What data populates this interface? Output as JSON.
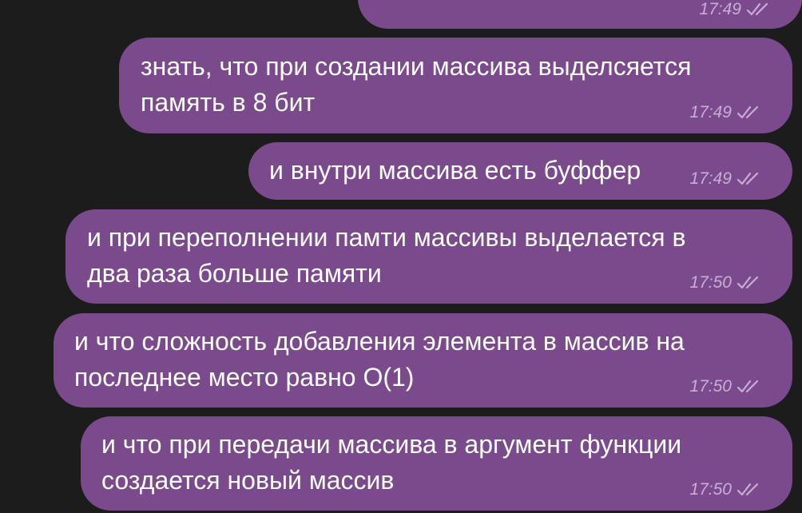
{
  "colors": {
    "background": "#1c1c1d",
    "bubble": "#7b4a8c",
    "meta": "#c9aed3"
  },
  "messages": [
    {
      "lines": [],
      "time": "17:49",
      "status": "read-double-check",
      "has_sticker": true
    },
    {
      "lines": [
        "знать, что при создании массива выделсяется",
        "память в 8 бит"
      ],
      "time": "17:49",
      "status": "read-double-check"
    },
    {
      "lines": [
        "и внутри массива есть буффер"
      ],
      "time": "17:49",
      "status": "read-double-check"
    },
    {
      "lines": [
        "и при переполнении памти массивы выделается в",
        "два раза больше памяти"
      ],
      "time": "17:50",
      "status": "read-double-check"
    },
    {
      "lines": [
        "и что сложность добавления элемента в массив на",
        "последнее место равно O(1)"
      ],
      "time": "17:50",
      "status": "read-double-check"
    },
    {
      "lines": [
        "и что при передачи массива в аргумент функции",
        "создается новый массив"
      ],
      "time": "17:50",
      "status": "read-double-check"
    }
  ]
}
